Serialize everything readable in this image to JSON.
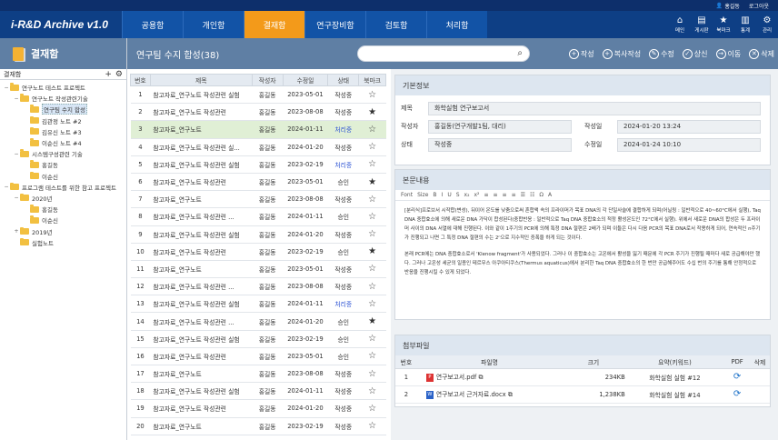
{
  "topbar": {
    "user": "홍길동",
    "logout": "로그아웃"
  },
  "app": {
    "title": "i-R&D Archive v1.0"
  },
  "nav": {
    "tabs": [
      {
        "label": "공용함"
      },
      {
        "label": "개인함"
      },
      {
        "label": "결재함"
      },
      {
        "label": "연구장비함"
      },
      {
        "label": "검토함"
      },
      {
        "label": "처리함"
      }
    ]
  },
  "header_icons": [
    {
      "label": "메인",
      "glyph": "⌂"
    },
    {
      "label": "게시판",
      "glyph": "▤"
    },
    {
      "label": "북마크",
      "glyph": "★"
    },
    {
      "label": "통계",
      "glyph": "▥"
    },
    {
      "label": "관리",
      "glyph": "⚙"
    }
  ],
  "sidebar": {
    "title": "결재함",
    "sub_title": "결재함",
    "tree": [
      {
        "label": "연구노트 테스트 프로젝트",
        "level": 0,
        "tw": "−"
      },
      {
        "label": "연구노트 작성관련기술",
        "level": 1,
        "tw": "−"
      },
      {
        "label": "연구팀 수지 합성",
        "level": 2,
        "tw": "",
        "selected": true
      },
      {
        "label": "김관정 노트 #2",
        "level": 2,
        "tw": ""
      },
      {
        "label": "김유신 노트 #3",
        "level": 2,
        "tw": ""
      },
      {
        "label": "이순신 노트 #4",
        "level": 2,
        "tw": ""
      },
      {
        "label": "시스템구성관련 기술",
        "level": 1,
        "tw": "−"
      },
      {
        "label": "홍길동",
        "level": 2,
        "tw": ""
      },
      {
        "label": "이순신",
        "level": 2,
        "tw": ""
      },
      {
        "label": "프로그램 테스트를 위한 참고 프로젝트",
        "level": 0,
        "tw": "−"
      },
      {
        "label": "2020년",
        "level": 1,
        "tw": "−"
      },
      {
        "label": "홍길동",
        "level": 2,
        "tw": ""
      },
      {
        "label": "이순신",
        "level": 2,
        "tw": ""
      },
      {
        "label": "2019년",
        "level": 1,
        "tw": "+"
      },
      {
        "label": "실험노트",
        "level": 1,
        "tw": ""
      }
    ]
  },
  "page": {
    "title": "연구팀 수지 합성(38)"
  },
  "actions": [
    {
      "label": "작성",
      "glyph": "+"
    },
    {
      "label": "복사작성",
      "glyph": "+"
    },
    {
      "label": "수정",
      "glyph": "✎"
    },
    {
      "label": "상신",
      "glyph": "✓"
    },
    {
      "label": "이동",
      "glyph": "→"
    },
    {
      "label": "삭제",
      "glyph": "✕"
    }
  ],
  "list": {
    "headers": [
      "번호",
      "제목",
      "작성자",
      "수정일",
      "상태",
      "북마크"
    ],
    "rows": [
      {
        "no": "1",
        "title": "참고자료_연구노트 작성관련 실험",
        "author": "홍길동",
        "date": "2023-05-01",
        "status": "작성중",
        "star": "☆",
        "sb": false
      },
      {
        "no": "2",
        "title": "참고자료_연구노트 작성관련",
        "author": "홍길동",
        "date": "2023-08-08",
        "status": "작성중",
        "star": "★",
        "sb": false
      },
      {
        "no": "3",
        "title": "참고자료_연구노트",
        "author": "홍길동",
        "date": "2024-01-11",
        "status": "처리중",
        "star": "☆",
        "sb": true,
        "hl": true
      },
      {
        "no": "4",
        "title": "참고자료_연구노트 작성관련 실...",
        "author": "홍길동",
        "date": "2024-01-20",
        "status": "작성중",
        "star": "☆",
        "sb": false
      },
      {
        "no": "5",
        "title": "참고자료_연구노트 작성관련 실험",
        "author": "홍길동",
        "date": "2023-02-19",
        "status": "처리중",
        "star": "☆",
        "sb": true
      },
      {
        "no": "6",
        "title": "참고자료_연구노트 작성관련",
        "author": "홍길동",
        "date": "2023-05-01",
        "status": "승인",
        "star": "★",
        "sb": false
      },
      {
        "no": "7",
        "title": "참고자료_연구노트",
        "author": "홍길동",
        "date": "2023-08-08",
        "status": "작성중",
        "star": "☆",
        "sb": false
      },
      {
        "no": "8",
        "title": "참고자료_연구노트 작성관련 ...",
        "author": "홍길동",
        "date": "2024-01-11",
        "status": "승인",
        "star": "☆",
        "sb": false
      },
      {
        "no": "9",
        "title": "참고자료_연구노트 작성관련 실험",
        "author": "홍길동",
        "date": "2024-01-20",
        "status": "작성중",
        "star": "☆",
        "sb": false
      },
      {
        "no": "10",
        "title": "참고자료_연구노트 작성관련",
        "author": "홍길동",
        "date": "2023-02-19",
        "status": "승인",
        "star": "★",
        "sb": false
      },
      {
        "no": "11",
        "title": "참고자료_연구노트",
        "author": "홍길동",
        "date": "2023-05-01",
        "status": "작성중",
        "star": "☆",
        "sb": false
      },
      {
        "no": "12",
        "title": "참고자료_연구노트 작성관련 ...",
        "author": "홍길동",
        "date": "2023-08-08",
        "status": "작성중",
        "star": "☆",
        "sb": false
      },
      {
        "no": "13",
        "title": "참고자료_연구노트 작성관련 실험",
        "author": "홍길동",
        "date": "2024-01-11",
        "status": "처리중",
        "star": "☆",
        "sb": true
      },
      {
        "no": "14",
        "title": "참고자료_연구노트 작성관련 ...",
        "author": "홍길동",
        "date": "2024-01-20",
        "status": "승인",
        "star": "★",
        "sb": false
      },
      {
        "no": "15",
        "title": "참고자료_연구노트 작성관련 실험",
        "author": "홍길동",
        "date": "2023-02-19",
        "status": "승인",
        "star": "☆",
        "sb": false
      },
      {
        "no": "16",
        "title": "참고자료_연구노트 작성관련",
        "author": "홍길동",
        "date": "2023-05-01",
        "status": "승인",
        "star": "☆",
        "sb": false
      },
      {
        "no": "17",
        "title": "참고자료_연구노트",
        "author": "홍길동",
        "date": "2023-08-08",
        "status": "작성중",
        "star": "☆",
        "sb": false
      },
      {
        "no": "18",
        "title": "참고자료_연구노트 작성관련 실험",
        "author": "홍길동",
        "date": "2024-01-11",
        "status": "작성중",
        "star": "☆",
        "sb": false
      },
      {
        "no": "19",
        "title": "참고자료_연구노트 작성관련",
        "author": "홍길동",
        "date": "2024-01-20",
        "status": "작성중",
        "star": "☆",
        "sb": false
      },
      {
        "no": "20",
        "title": "참고자료_연구노트",
        "author": "홍길동",
        "date": "2023-02-19",
        "status": "작성중",
        "star": "☆",
        "sb": false
      }
    ]
  },
  "detail": {
    "basic_title": "기본정보",
    "subject_label": "제목",
    "subject": "화학실험 연구보고서",
    "author_label": "작성자",
    "author": "홍길동(연구개발1팀, 대리)",
    "created_label": "작성일",
    "created": "2024-01-20  13:24",
    "status_label": "상태",
    "status": "작성중",
    "modified_label": "수정일",
    "modified": "2024-01-24  10:10",
    "body_title": "본문내용",
    "toolbar": [
      "Font",
      "Size",
      "B",
      "I",
      "U",
      "S",
      "x₂",
      "x²",
      "≡",
      "≡",
      "≡",
      "≡",
      "☰",
      "☷",
      "Ω",
      "A"
    ],
    "p1": "[분리식]프로브서 시작합(변성), 뒤이어 온도를 낮춤으로써 혼합액 속의 프라이머가 목표 DNA의 각 단일사슬에 결합하게 되며(어닐링 : 일반적으로 40~60°C에서 실행), Taq DNA 중합효소에 의해 새로운 DNA 가닥이 합성된다(중합반응 : 일반적으로 Taq DNA 중합효소의 적정 활성온도인 72°C에서 실행). 위에서 새로운 DNA의 합성은 두 프라이머 사이의 DNA 서열에 대해 진행된다. 이와 같이 1주기의 PCR에 의해 특정 DNA 절편은 2배가 되며 이들은 다시 다음 PCR의 목표 DNA로서 작용하게 되어, 연속적인 n주기가 진행되고 나면 그 특정 DNA 절편의 수는 2ⁿ으로 지수적인 증폭을 하게 되는 것이다.",
    "p2": "본래 PCR에는 DNA 중합효소로서 'Klenow fragment'가 사용되었다. 그러나 이 중합효소는 고온에서 활성을 잃기 때문에 각 PCR 주기가 진행될 때마다 새로 공급해야만 했다. 그러나 고온성 세균의 일종인 테르무스 아쿠아티쿠스(Thermus aquaticus)에서 분리한 Taq DNA 중합효소의 한 번만 공급해주어도 수십 번의 주기를 통해 안정적으로 반응을 진행시킬 수 있게 되었다."
  },
  "attach": {
    "title": "첨부파일",
    "headers": [
      "번호",
      "파일명",
      "크기",
      "요약(키워드)",
      "PDF",
      "삭제"
    ],
    "rows": [
      {
        "no": "1",
        "type": "pdf",
        "name": "연구보고서.pdf",
        "size": "234KB",
        "summary": "화학실험 실험 #12"
      },
      {
        "no": "2",
        "type": "doc",
        "name": "연구보고서 근거자료.docx",
        "size": "1,238KB",
        "summary": "화학실험 실험 #14"
      }
    ]
  }
}
